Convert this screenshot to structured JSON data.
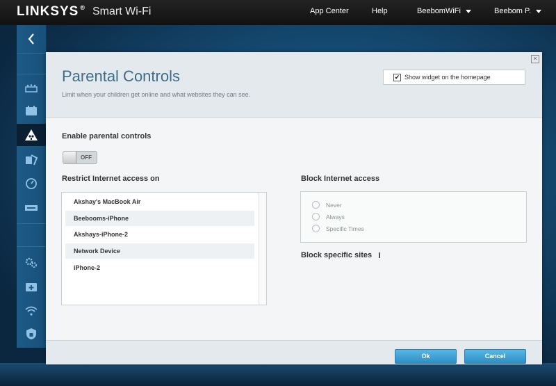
{
  "header": {
    "brand": "LINKSYS",
    "brand_tm": "®",
    "product": "Smart Wi-Fi",
    "nav": {
      "app_center": "App Center",
      "help": "Help",
      "network": "BeebomWiFi",
      "user": "Beebom P."
    }
  },
  "sidebar": {
    "icons": [
      "back-chevron-icon",
      "device-list-icon",
      "wifi-schedule-icon",
      "parental-controls-icon",
      "media-prioritization-icon",
      "speed-test-icon",
      "external-storage-icon",
      "connectivity-icon",
      "troubleshooting-icon",
      "wireless-icon",
      "security-icon"
    ],
    "active": "parental-controls-icon"
  },
  "panel": {
    "close_glyph": "×",
    "title": "Parental Controls",
    "subtitle": "Limit when your children get online and what websites they can see.",
    "widget_checkbox": {
      "checked": true,
      "check_glyph": "✔",
      "label": "Show widget on the homepage"
    },
    "enable_label": "Enable parental controls",
    "toggle": {
      "state": "OFF"
    },
    "restrict_label": "Restrict Internet access on",
    "devices": [
      "Akshay's MacBook Air",
      "Beebooms-iPhone",
      "Akshays-iPhone-2",
      "Network Device",
      "iPhone-2"
    ],
    "block_label": "Block Internet access",
    "block_options": [
      "Never",
      "Always",
      "Specific Times"
    ],
    "block_sites_label": "Block specific sites",
    "ok_label": "Ok",
    "cancel_label": "Cancel"
  },
  "colors": {
    "title": "#3d6d8a",
    "button": "#2c8fc6",
    "topbar": "#1a1a1a",
    "sidebar": "#1d5a86"
  }
}
